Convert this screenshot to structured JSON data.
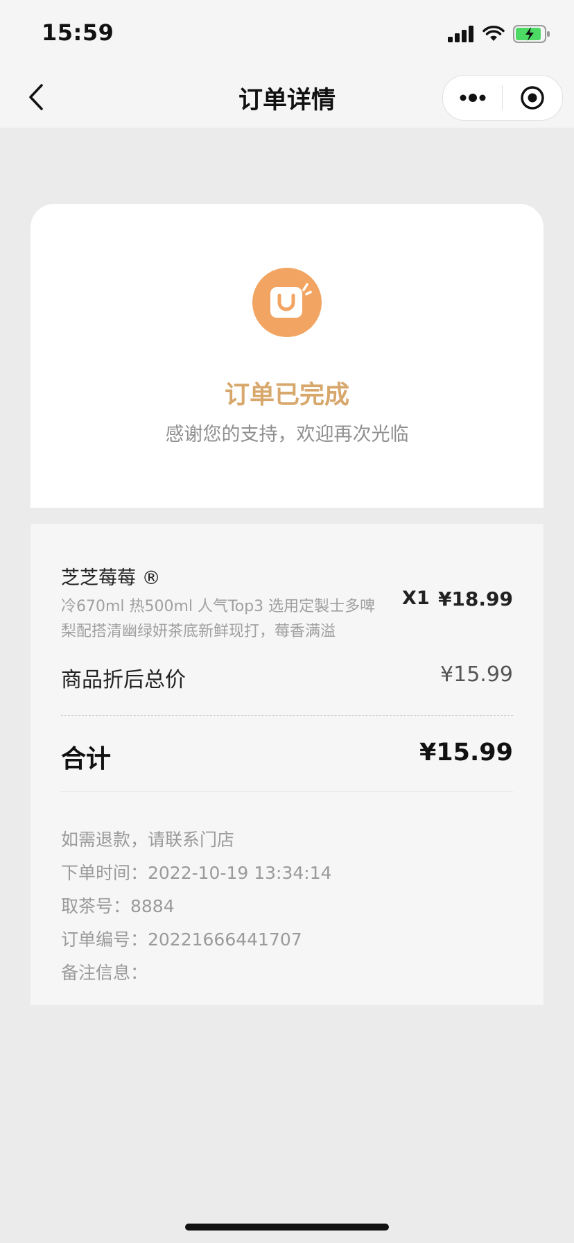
{
  "status_bar": {
    "time": "15:59",
    "icons": [
      "cellular-signal-icon",
      "wifi-icon",
      "battery-charging-icon"
    ]
  },
  "nav": {
    "back_icon": "chevron-left-icon",
    "title": "订单详情",
    "capsule_icons": [
      "more-dots-icon",
      "close-target-icon"
    ]
  },
  "order_status": {
    "icon": "shopping-bag-icon",
    "title": "订单已完成",
    "subtitle": "感谢您的支持，欢迎再次光临"
  },
  "item": {
    "name": "芝芝莓莓 ®",
    "description": "冷670ml 热500ml 人气Top3 选用定製士多啤梨配搭清幽绿妍茶底新鲜现打，莓香满溢",
    "quantity": "X1",
    "price": "¥18.99"
  },
  "summary": {
    "discount_label": "商品折后总价",
    "discount_value": "¥15.99",
    "total_label": "合计",
    "total_value": "¥15.99"
  },
  "info": {
    "refund_note": "如需退款，请联系门店",
    "order_time": "下单时间：2022-10-19 13:34:14",
    "pickup_number": "取茶号：8884",
    "order_number": "订单编号：20221666441707",
    "remarks": "备注信息："
  },
  "colors": {
    "accent": "#f2a562",
    "status_title": "#d7a76b",
    "page_background": "#ebebeb"
  }
}
